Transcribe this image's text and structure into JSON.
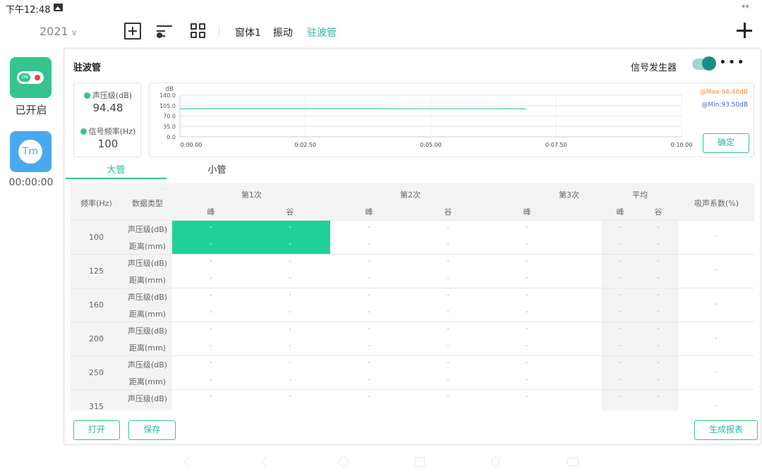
{
  "status_bar": {
    "time": "下午12:48",
    "right_icon": "resize-arrows-icon"
  },
  "topbar": {
    "year": "2021",
    "tabs": [
      "窗体1",
      "振动",
      "驻波管"
    ],
    "active_tab": "驻波管",
    "icons": [
      "add-box-icon",
      "filter-settings-icon",
      "grid-icon",
      "plus-icon"
    ]
  },
  "sidebar": {
    "status_label": "已开启",
    "tm_label": "Tm",
    "timer": "00:00:00"
  },
  "panel": {
    "title": "驻波管",
    "signal_label": "信号发生器",
    "signal_on": true,
    "more": "•••"
  },
  "meter": {
    "spl_label": "声压级(dB)",
    "spl_value": "94.48",
    "freq_label": "信号频率(Hz)",
    "freq_value": "100"
  },
  "chart_data": {
    "type": "line",
    "ylabel": "dB",
    "yticks": [
      "140.0",
      "105.0",
      "70.0",
      "35.0",
      "0.0"
    ],
    "xticks": [
      "0:00.00",
      "0:02.50",
      "0:05.00",
      "0:07.50",
      "0:10.00"
    ],
    "ylim": [
      0,
      140
    ],
    "xlim": [
      0,
      10
    ],
    "series": [
      {
        "x": [
          0,
          2.5,
          5.0,
          6.9
        ],
        "y": [
          94.4,
          94.3,
          94.5,
          94.4
        ]
      }
    ],
    "legend_max": "@Max:94.48dB",
    "legend_min": "@Min:93.50dB",
    "grid": true,
    "color": "#3ccfa0"
  },
  "chart_confirm": "确定",
  "tube_tabs": {
    "big": "大管",
    "small": "小管"
  },
  "table": {
    "headers": {
      "freq": "频率(Hz)",
      "dtype": "数据类型",
      "run1": "第1次",
      "run2": "第2次",
      "run3": "第3次",
      "avg": "平均",
      "absorb": "吸声系数(%)",
      "peak": "峰",
      "valley": "谷"
    },
    "rows": [
      "100",
      "125",
      "160",
      "200",
      "250",
      "315"
    ],
    "dtype_spl": "声压级(dB)",
    "dtype_dist": "距离(mm)",
    "empty": "-"
  },
  "buttons": {
    "open": "打开",
    "save": "保存",
    "report": "生成报表"
  },
  "colors": {
    "accent": "#35c48e",
    "tab_active": "#2bb6a0",
    "highlight": "#1fd198",
    "tm_blue": "#4aa8ee",
    "max": "#f08a3c",
    "min": "#3b63d8"
  }
}
